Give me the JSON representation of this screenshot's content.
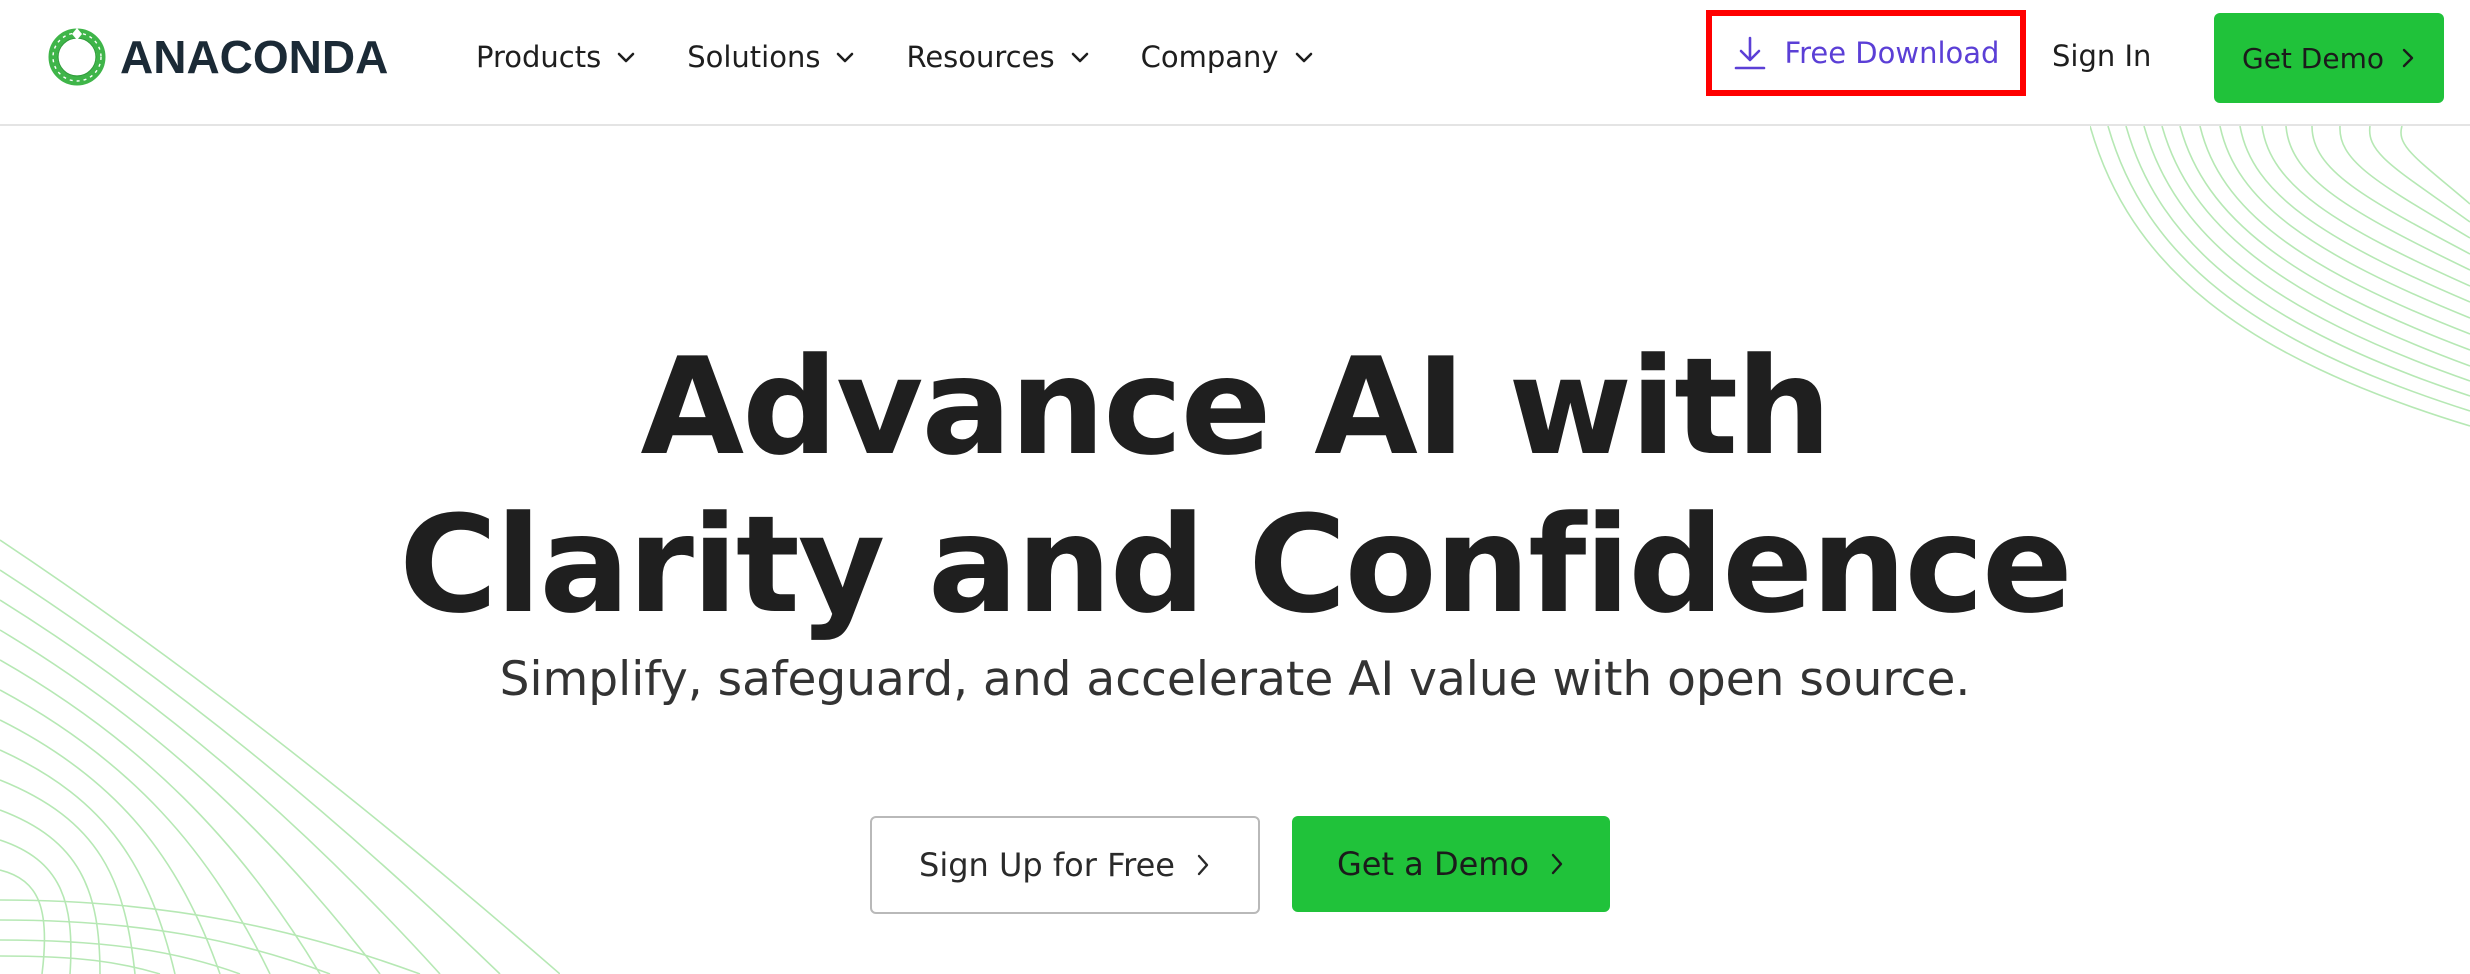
{
  "header": {
    "logo": {
      "text": "ANACONDA",
      "icon": "anaconda-ring-logo"
    },
    "nav": [
      {
        "label": "Products",
        "icon": "chevron-down-icon"
      },
      {
        "label": "Solutions",
        "icon": "chevron-down-icon"
      },
      {
        "label": "Resources",
        "icon": "chevron-down-icon"
      },
      {
        "label": "Company",
        "icon": "chevron-down-icon"
      }
    ],
    "free_download": {
      "label": "Free Download",
      "icon": "download-icon"
    },
    "sign_in": {
      "label": "Sign In"
    },
    "get_demo": {
      "label": "Get Demo",
      "icon": "chevron-right-icon"
    }
  },
  "hero": {
    "title_line1": "Advance AI with",
    "title_line2": "Clarity and Confidence",
    "subtitle": "Simplify, safeguard, and accelerate AI value with open source.",
    "cta_signup": {
      "label": "Sign Up for Free",
      "icon": "chevron-right-icon"
    },
    "cta_demo": {
      "label": "Get a Demo",
      "icon": "chevron-right-icon"
    }
  },
  "colors": {
    "brand_green": "#20c23a",
    "link_purple": "#5b3fd6",
    "highlight_red": "#ff0000",
    "deco_line_green": "#b6e8b4"
  }
}
